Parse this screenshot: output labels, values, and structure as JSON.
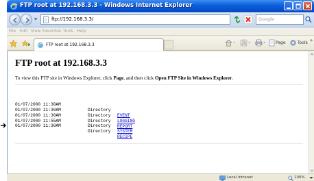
{
  "window": {
    "title": "FTP root at 192.168.3.3 - Windows Internet Explorer"
  },
  "address": {
    "url": "ftp://192.168.3.3/"
  },
  "search": {
    "placeholder": "Google"
  },
  "menu": {
    "file": "File",
    "edit": "Edit",
    "view": "View",
    "favorites": "Favorites",
    "tools": "Tools",
    "help": "Help"
  },
  "tab": {
    "label": "FTP root at 192.168.3.3"
  },
  "command_bar": {
    "page": "Page",
    "tools": "Tools",
    "more": "»"
  },
  "page": {
    "title": "FTP root at 192.168.3.3",
    "instructions_part1": "To view this FTP site in Windows Explorer, click ",
    "instructions_page": "Page",
    "instructions_part2": ", and then click ",
    "instructions_open": "Open FTP Site in Windows Explorer",
    "instructions_end": "."
  },
  "listing": [
    {
      "datetime": "01/07/2000 11:30AM",
      "type": "Directory",
      "name": "EVENT"
    },
    {
      "datetime": "01/07/2000 11:30AM",
      "type": "Directory",
      "name": "LOGGING"
    },
    {
      "datetime": "01/07/2000 11:30AM",
      "type": "Directory",
      "name": "REPORT"
    },
    {
      "datetime": "01/07/2000 11:55AM",
      "type": "Directory",
      "name": "SYSTEM"
    },
    {
      "datetime": "01/07/2000 11:30AM",
      "type": "Directory",
      "name": "RECIPE"
    }
  ],
  "status": {
    "zone": "Local intranet",
    "zoom": "100%"
  },
  "colors": {
    "titlebar": "#0a5fd8",
    "link": "#0000cc"
  }
}
